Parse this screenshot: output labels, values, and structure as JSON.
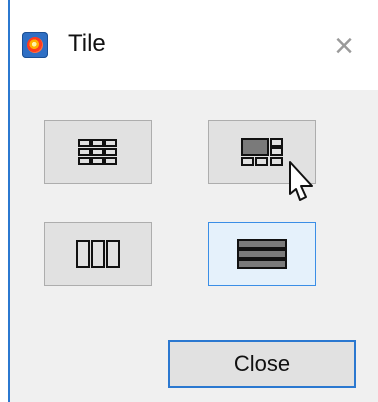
{
  "window": {
    "title": "Tile",
    "app_icon": "tile-app-icon",
    "close_icon": "close-icon",
    "colors": {
      "accent": "#2b78d0",
      "content_bg": "#f0f0f0",
      "button_bg": "#e1e1e1",
      "selected_bg": "#e5f1fb"
    }
  },
  "tile_options": [
    {
      "name": "grid",
      "icon": "tile-grid-icon",
      "selected": false
    },
    {
      "name": "mixed",
      "icon": "tile-mixed-icon",
      "selected": false
    },
    {
      "name": "vertical",
      "icon": "tile-vertical-icon",
      "selected": false
    },
    {
      "name": "horizontal",
      "icon": "tile-horizontal-icon",
      "selected": true
    }
  ],
  "footer": {
    "close_label": "Close"
  }
}
